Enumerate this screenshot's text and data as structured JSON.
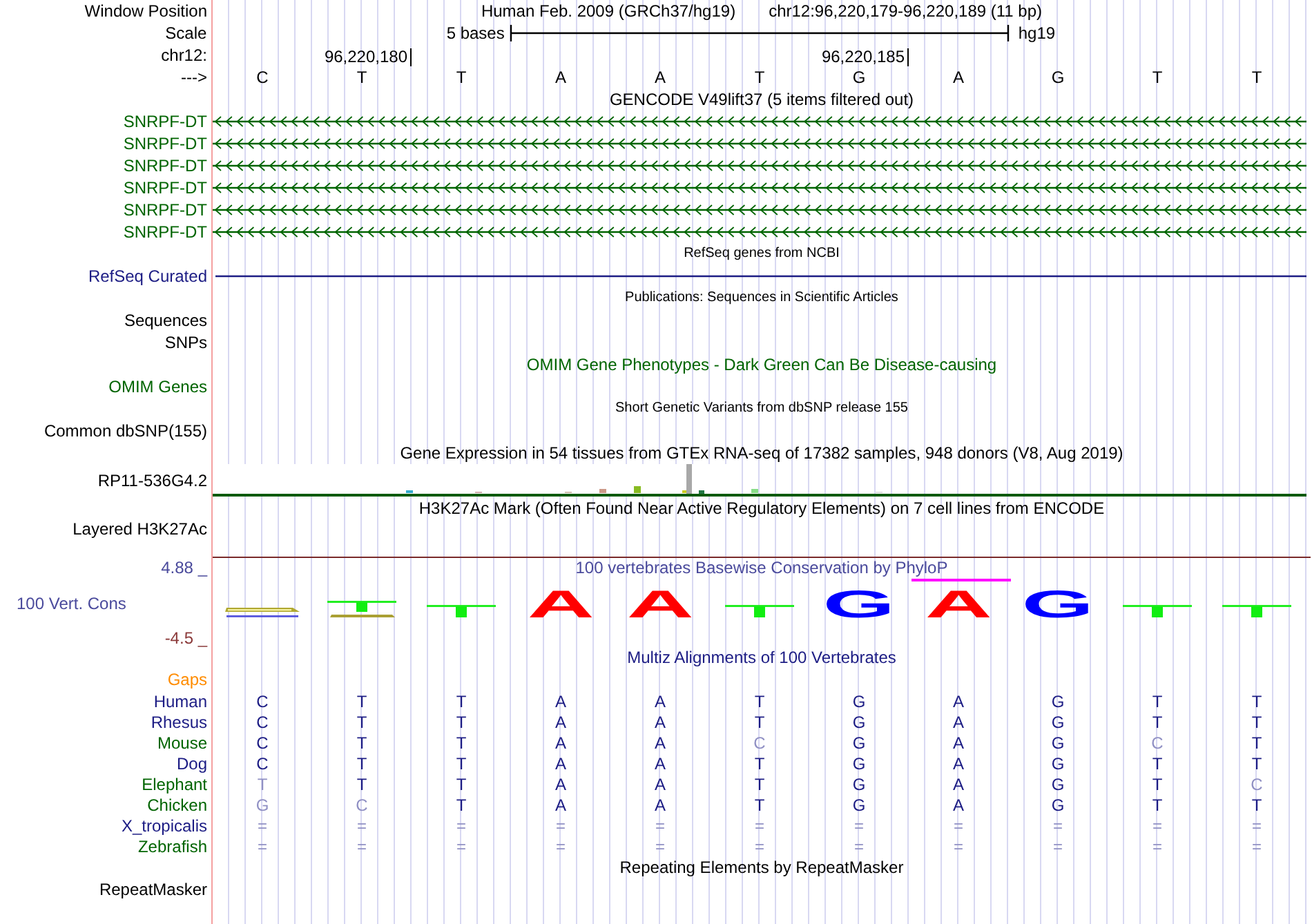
{
  "ruler": {
    "position_label": "Window Position",
    "assembly": "Human Feb. 2009 (GRCh37/hg19)",
    "range": "chr12:96,220,179-96,220,189 (11 bp)",
    "scale_label": "Scale",
    "scale_text": "5 bases",
    "scale_db": "hg19",
    "chrom_label": "chr12:",
    "strand_label": "--->",
    "bases": [
      {
        "letter": "C"
      },
      {
        "letter": "T",
        "tick": "96,220,180"
      },
      {
        "letter": "T"
      },
      {
        "letter": "A"
      },
      {
        "letter": "A"
      },
      {
        "letter": "T"
      },
      {
        "letter": "G",
        "tick": "96,220,185"
      },
      {
        "letter": "A"
      },
      {
        "letter": "G"
      },
      {
        "letter": "T"
      },
      {
        "letter": "T"
      }
    ]
  },
  "tracks": [
    {
      "kind": "title",
      "text": "GENCODE V49lift37 (5 items filtered out)",
      "color": "#000000"
    },
    {
      "kind": "gene",
      "label": "SNRPF-DT",
      "color": "#006400"
    },
    {
      "kind": "gene",
      "label": "SNRPF-DT",
      "color": "#006400"
    },
    {
      "kind": "gene",
      "label": "SNRPF-DT",
      "color": "#006400"
    },
    {
      "kind": "gene",
      "label": "SNRPF-DT",
      "color": "#006400"
    },
    {
      "kind": "gene",
      "label": "SNRPF-DT",
      "color": "#006400"
    },
    {
      "kind": "gene",
      "label": "SNRPF-DT",
      "color": "#006400"
    },
    {
      "kind": "note",
      "text": "RefSeq genes from NCBI"
    },
    {
      "kind": "line",
      "label": "RefSeq Curated",
      "color": "#1c1c84"
    },
    {
      "kind": "note",
      "text": "Publications: Sequences in Scientific Articles"
    },
    {
      "kind": "label",
      "label": "Sequences",
      "color": "#000000"
    },
    {
      "kind": "label",
      "label": "SNPs",
      "color": "#000000"
    },
    {
      "kind": "title",
      "text": "OMIM Gene Phenotypes - Dark Green Can Be Disease-causing",
      "color": "#006400"
    },
    {
      "kind": "label",
      "label": "OMIM Genes",
      "color": "#006400"
    },
    {
      "kind": "note",
      "text": "Short Genetic Variants from dbSNP release 155"
    },
    {
      "kind": "label",
      "label": "Common dbSNP(155)",
      "color": "#000000"
    },
    {
      "kind": "title",
      "text": "Gene Expression in 54 tissues from GTEx RNA-seq of 17382 samples, 948 donors (V8, Aug 2019)",
      "color": "#000000"
    },
    {
      "kind": "expression",
      "label": "RP11-536G4.2"
    },
    {
      "kind": "title",
      "text": "H3K27Ac Mark (Often Found Near Active Regulatory Elements) on 7 cell lines from ENCODE",
      "color": "#000000"
    },
    {
      "kind": "layered",
      "label": "Layered H3K27Ac"
    },
    {
      "kind": "conservation",
      "title": "100 vertebrates Basewise Conservation by PhyloP",
      "label": "100 Vert. Cons",
      "max": "4.88 _",
      "min": "-4.5 _",
      "logos": [
        {
          "kind": "smear",
          "highlight": false
        },
        {
          "kind": "mixed",
          "highlight": false
        },
        {
          "kind": "bar",
          "highlight": false
        },
        {
          "kind": "letter",
          "text": "A",
          "color": "#ff0000",
          "highlight": false
        },
        {
          "kind": "letter",
          "text": "A",
          "color": "#ff0000",
          "highlight": false
        },
        {
          "kind": "bar",
          "highlight": false
        },
        {
          "kind": "letter",
          "text": "G",
          "color": "#0000ff",
          "highlight": false
        },
        {
          "kind": "letter",
          "text": "A",
          "color": "#ff0000",
          "highlight": true
        },
        {
          "kind": "letter",
          "text": "G",
          "color": "#0000ff",
          "highlight": false
        },
        {
          "kind": "bar",
          "highlight": false
        },
        {
          "kind": "bar",
          "highlight": false
        }
      ]
    },
    {
      "kind": "title",
      "text": "Multiz Alignments of 100 Vertebrates",
      "color": "#1c1c84"
    },
    {
      "kind": "label",
      "label": "Gaps",
      "color": "#ff8c00"
    },
    {
      "kind": "species",
      "label": "Human",
      "color": "#1c1c84",
      "bases": [
        {
          "b": "C",
          "faded": false
        },
        {
          "b": "T",
          "faded": false
        },
        {
          "b": "T",
          "faded": false
        },
        {
          "b": "A",
          "faded": false
        },
        {
          "b": "A",
          "faded": false
        },
        {
          "b": "T",
          "faded": false
        },
        {
          "b": "G",
          "faded": false
        },
        {
          "b": "A",
          "faded": false
        },
        {
          "b": "G",
          "faded": false
        },
        {
          "b": "T",
          "faded": false
        },
        {
          "b": "T",
          "faded": false
        }
      ]
    },
    {
      "kind": "species",
      "label": "Rhesus",
      "color": "#1c1c84",
      "bases": [
        {
          "b": "C",
          "faded": false
        },
        {
          "b": "T",
          "faded": false
        },
        {
          "b": "T",
          "faded": false
        },
        {
          "b": "A",
          "faded": false
        },
        {
          "b": "A",
          "faded": false
        },
        {
          "b": "T",
          "faded": false
        },
        {
          "b": "G",
          "faded": false
        },
        {
          "b": "A",
          "faded": false
        },
        {
          "b": "G",
          "faded": false
        },
        {
          "b": "T",
          "faded": false
        },
        {
          "b": "T",
          "faded": false
        }
      ]
    },
    {
      "kind": "species",
      "label": "Mouse",
      "color": "#006400",
      "bases": [
        {
          "b": "C",
          "faded": false
        },
        {
          "b": "T",
          "faded": false
        },
        {
          "b": "T",
          "faded": false
        },
        {
          "b": "A",
          "faded": false
        },
        {
          "b": "A",
          "faded": false
        },
        {
          "b": "C",
          "faded": true
        },
        {
          "b": "G",
          "faded": false
        },
        {
          "b": "A",
          "faded": false
        },
        {
          "b": "G",
          "faded": false
        },
        {
          "b": "C",
          "faded": true
        },
        {
          "b": "T",
          "faded": false
        }
      ]
    },
    {
      "kind": "species",
      "label": "Dog",
      "color": "#1c1c84",
      "bases": [
        {
          "b": "C",
          "faded": false
        },
        {
          "b": "T",
          "faded": false
        },
        {
          "b": "T",
          "faded": false
        },
        {
          "b": "A",
          "faded": false
        },
        {
          "b": "A",
          "faded": false
        },
        {
          "b": "T",
          "faded": false
        },
        {
          "b": "G",
          "faded": false
        },
        {
          "b": "A",
          "faded": false
        },
        {
          "b": "G",
          "faded": false
        },
        {
          "b": "T",
          "faded": false
        },
        {
          "b": "T",
          "faded": false
        }
      ]
    },
    {
      "kind": "species",
      "label": "Elephant",
      "color": "#006400",
      "bases": [
        {
          "b": "T",
          "faded": true
        },
        {
          "b": "T",
          "faded": false
        },
        {
          "b": "T",
          "faded": false
        },
        {
          "b": "A",
          "faded": false
        },
        {
          "b": "A",
          "faded": false
        },
        {
          "b": "T",
          "faded": false
        },
        {
          "b": "G",
          "faded": false
        },
        {
          "b": "A",
          "faded": false
        },
        {
          "b": "G",
          "faded": false
        },
        {
          "b": "T",
          "faded": false
        },
        {
          "b": "C",
          "faded": true
        }
      ]
    },
    {
      "kind": "species",
      "label": "Chicken",
      "color": "#006400",
      "bases": [
        {
          "b": "G",
          "faded": true
        },
        {
          "b": "C",
          "faded": true
        },
        {
          "b": "T",
          "faded": false
        },
        {
          "b": "A",
          "faded": false
        },
        {
          "b": "A",
          "faded": false
        },
        {
          "b": "T",
          "faded": false
        },
        {
          "b": "G",
          "faded": false
        },
        {
          "b": "A",
          "faded": false
        },
        {
          "b": "G",
          "faded": false
        },
        {
          "b": "T",
          "faded": false
        },
        {
          "b": "T",
          "faded": false
        }
      ]
    },
    {
      "kind": "species",
      "label": "X_tropicalis",
      "color": "#1c1c84",
      "bases": [
        {
          "b": "=",
          "faded": true
        },
        {
          "b": "=",
          "faded": true
        },
        {
          "b": "=",
          "faded": true
        },
        {
          "b": "=",
          "faded": true
        },
        {
          "b": "=",
          "faded": true
        },
        {
          "b": "=",
          "faded": true
        },
        {
          "b": "=",
          "faded": true
        },
        {
          "b": "=",
          "faded": true
        },
        {
          "b": "=",
          "faded": true
        },
        {
          "b": "=",
          "faded": true
        },
        {
          "b": "=",
          "faded": true
        }
      ]
    },
    {
      "kind": "species",
      "label": "Zebrafish",
      "color": "#006400",
      "bases": [
        {
          "b": "=",
          "faded": true
        },
        {
          "b": "=",
          "faded": true
        },
        {
          "b": "=",
          "faded": true
        },
        {
          "b": "=",
          "faded": true
        },
        {
          "b": "=",
          "faded": true
        },
        {
          "b": "=",
          "faded": true
        },
        {
          "b": "=",
          "faded": true
        },
        {
          "b": "=",
          "faded": true
        },
        {
          "b": "=",
          "faded": true
        },
        {
          "b": "=",
          "faded": true
        },
        {
          "b": "=",
          "faded": true
        }
      ]
    },
    {
      "kind": "title",
      "text": "Repeating Elements by RepeatMasker",
      "color": "#000000"
    },
    {
      "kind": "label",
      "label": "RepeatMasker",
      "color": "#000000"
    }
  ]
}
